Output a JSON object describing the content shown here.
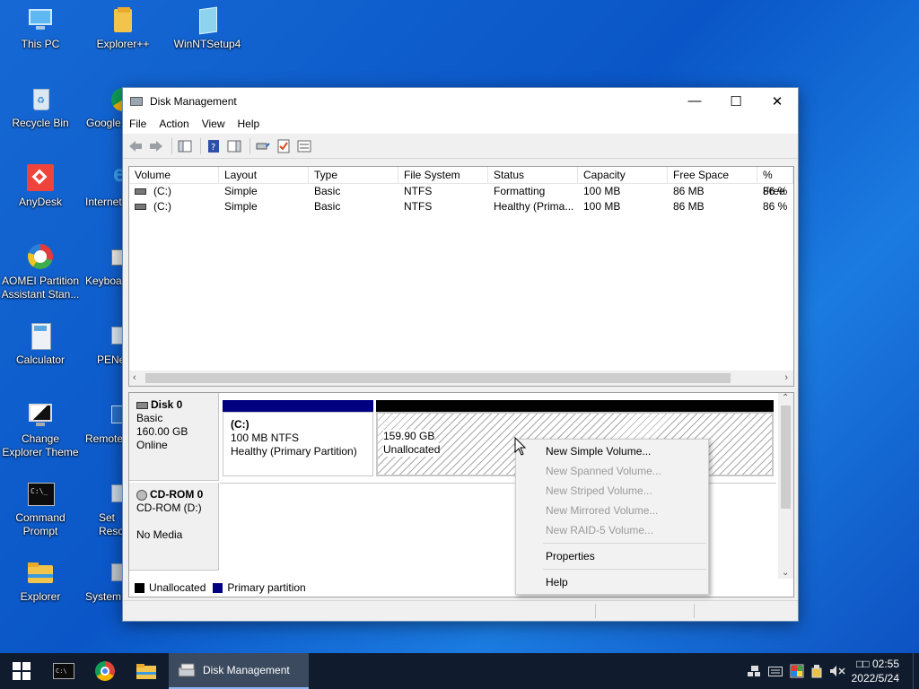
{
  "desktop": {
    "icons": [
      {
        "label": "This PC"
      },
      {
        "label": "Explorer++"
      },
      {
        "label": "WinNTSetup4"
      },
      {
        "label": "Recycle Bin"
      },
      {
        "label": "Google"
      },
      {
        "label": "AnyDesk"
      },
      {
        "label": "Internet"
      },
      {
        "label": "AOMEI Partition Assistant Stan..."
      },
      {
        "label": "Keyboa"
      },
      {
        "label": "Calculator"
      },
      {
        "label": "PENe"
      },
      {
        "label": "Change Explorer Theme"
      },
      {
        "label": "Remote"
      },
      {
        "label": "Command Prompt"
      },
      {
        "label": "Set Reso"
      },
      {
        "label": "Explorer"
      },
      {
        "label": "System"
      }
    ]
  },
  "window": {
    "title": "Disk Management",
    "minimize": "—",
    "maximize": "☐",
    "close": "✕"
  },
  "menu": [
    "File",
    "Action",
    "View",
    "Help"
  ],
  "volume_list": {
    "columns": [
      "Volume",
      "Layout",
      "Type",
      "File System",
      "Status",
      "Capacity",
      "Free Space",
      "% Free"
    ],
    "rows": [
      [
        "(C:)",
        "Simple",
        "Basic",
        "NTFS",
        "Formatting",
        "100 MB",
        "86 MB",
        "86 %"
      ],
      [
        "(C:)",
        "Simple",
        "Basic",
        "NTFS",
        "Healthy (Prima...",
        "100 MB",
        "86 MB",
        "86 %"
      ]
    ]
  },
  "disks": {
    "disk0": {
      "name": "Disk 0",
      "type": "Basic",
      "size": "160.00 GB",
      "state": "Online",
      "partition_c": {
        "name": "(C:)",
        "size_fs": "100 MB NTFS",
        "status": "Healthy (Primary Partition)"
      },
      "unallocated": {
        "size": "159.90 GB",
        "status": "Unallocated"
      }
    },
    "cdrom0": {
      "name": "CD-ROM 0",
      "drive": "CD-ROM (D:)",
      "media": "No Media"
    }
  },
  "legend": [
    {
      "label": "Unallocated",
      "color": "#000000"
    },
    {
      "label": "Primary partition",
      "color": "#000080"
    }
  ],
  "context_menu": {
    "new_simple": "New Simple Volume...",
    "new_spanned": "New Spanned Volume...",
    "new_striped": "New Striped Volume...",
    "new_mirrored": "New Mirrored Volume...",
    "new_raid5": "New RAID-5 Volume...",
    "properties": "Properties",
    "help": "Help"
  },
  "taskbar": {
    "active_app": "Disk Management",
    "time": "02:55",
    "time_prefix": "□□",
    "date": "2022/5/24"
  },
  "colors": {
    "primary_partition": "#000080",
    "unallocated": "#000000",
    "desktop": "#0a56c8",
    "taskbar": "#101c2e"
  }
}
